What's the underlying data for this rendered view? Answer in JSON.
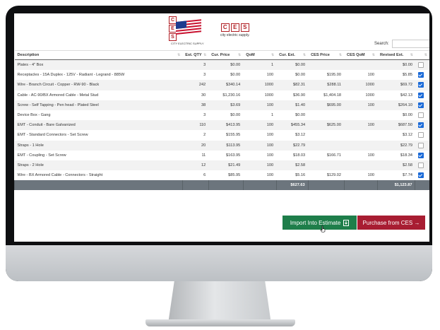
{
  "logo": {
    "letters": [
      "C",
      "E",
      "S"
    ],
    "left_caption": "CITY ELECTRIC SUPPLY",
    "right_caption": "city electric supply."
  },
  "search": {
    "label": "Search:",
    "placeholder": ""
  },
  "columns": [
    "Description",
    "Est. QTY",
    "Cur. Price",
    "QoM",
    "Cur. Ext.",
    "CES Price",
    "CES QoM",
    "Revised Ext.",
    ""
  ],
  "rows": [
    {
      "desc": "Plates - 4\" Box",
      "qty": "3",
      "cur_price": "$0.00",
      "qom": "1",
      "cur_ext": "$0.00",
      "ces_price": "",
      "ces_qom": "",
      "revised": "$0.00",
      "checked": false
    },
    {
      "desc": "Receptacles - 15A Duplex - 125V - Radiant - Legrand - 885W",
      "qty": "3",
      "cur_price": "$0.00",
      "qom": "100",
      "cur_ext": "$0.00",
      "ces_price": "$195.00",
      "ces_qom": "100",
      "revised": "$5.85",
      "checked": true
    },
    {
      "desc": "Wire - Branch Circuit - Copper - RW-90 - Black",
      "qty": "242",
      "cur_price": "$340.14",
      "qom": "1000",
      "cur_ext": "$82.31",
      "ces_price": "$288.11",
      "ces_qom": "1000",
      "revised": "$69.72",
      "checked": true
    },
    {
      "desc": "Cable - AC-90/BX Armored Cable - Metal Stud",
      "qty": "30",
      "cur_price": "$1,230.16",
      "qom": "1000",
      "cur_ext": "$36.90",
      "ces_price": "$1,404.18",
      "ces_qom": "1000",
      "revised": "$42.13",
      "checked": true
    },
    {
      "desc": "Screw - Self Tapping - Pen head - Plated Steel",
      "qty": "38",
      "cur_price": "$3.69",
      "qom": "100",
      "cur_ext": "$1.40",
      "ces_price": "$695.00",
      "ces_qom": "100",
      "revised": "$264.10",
      "checked": true
    },
    {
      "desc": "Device Box - Gang",
      "qty": "3",
      "cur_price": "$0.00",
      "qom": "1",
      "cur_ext": "$0.00",
      "ces_price": "",
      "ces_qom": "",
      "revised": "$0.00",
      "checked": false
    },
    {
      "desc": "EMT - Conduit - Bare Galvanized",
      "qty": "110",
      "cur_price": "$413.95",
      "qom": "100",
      "cur_ext": "$455.34",
      "ces_price": "$625.00",
      "ces_qom": "100",
      "revised": "$687.50",
      "checked": true
    },
    {
      "desc": "EMT - Standard Connectors - Set Screw",
      "qty": "2",
      "cur_price": "$155.95",
      "qom": "100",
      "cur_ext": "$3.12",
      "ces_price": "",
      "ces_qom": "",
      "revised": "$3.12",
      "checked": false
    },
    {
      "desc": "Straps - 1 Hole",
      "qty": "20",
      "cur_price": "$113.95",
      "qom": "100",
      "cur_ext": "$22.79",
      "ces_price": "",
      "ces_qom": "",
      "revised": "$22.79",
      "checked": false
    },
    {
      "desc": "EMT - Coupling - Set Screw",
      "qty": "11",
      "cur_price": "$163.95",
      "qom": "100",
      "cur_ext": "$18.03",
      "ces_price": "$166.71",
      "ces_qom": "100",
      "revised": "$18.34",
      "checked": true
    },
    {
      "desc": "Straps - 2 Hole",
      "qty": "12",
      "cur_price": "$21.49",
      "qom": "100",
      "cur_ext": "$2.58",
      "ces_price": "",
      "ces_qom": "",
      "revised": "$2.58",
      "checked": false
    },
    {
      "desc": "Wire - BX Armored Cable - Connectors - Straight",
      "qty": "6",
      "cur_price": "$85.95",
      "qom": "100",
      "cur_ext": "$5.16",
      "ces_price": "$129.02",
      "ces_qom": "100",
      "revised": "$7.74",
      "checked": true
    }
  ],
  "totals": {
    "cur_ext": "$627.63",
    "revised": "$1,123.87"
  },
  "buttons": {
    "import": "Import Into Estimate",
    "purchase": "Purchase from CES →"
  },
  "colors": {
    "import_green": "#1e7e4a",
    "purchase_red": "#a81d32",
    "checkbox_blue": "#1a6ad8",
    "footer_gray": "#6c757d"
  }
}
